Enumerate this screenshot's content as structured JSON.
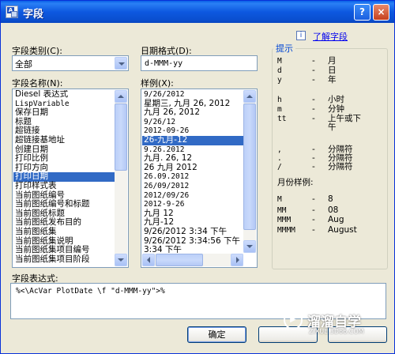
{
  "window": {
    "title": "字段",
    "help_button": "?",
    "close_button": "×"
  },
  "category": {
    "label": "字段类别(C):",
    "value": "全部"
  },
  "date_format": {
    "label": "日期格式(D):",
    "value": "d-MMM-yy"
  },
  "field_names": {
    "label": "字段名称(N):",
    "items": [
      "Diesel 表达式",
      "LispVariable",
      "保存日期",
      "标题",
      "超链接",
      "超链接基地址",
      "创建日期",
      "打印比例",
      "打印方向",
      "打印日期",
      "打印样式表",
      "当前图纸编号",
      "当前图纸编号和标题",
      "当前图纸标题",
      "当前图纸发布目的",
      "当前图纸集",
      "当前图纸集说明",
      "当前图纸集项目编号",
      "当前图纸集项目阶段"
    ],
    "selected": "打印日期"
  },
  "examples": {
    "label": "样例(X):",
    "items": [
      "9/26/2012",
      "星期三, 九月 26, 2012",
      "九月 26, 2012",
      "9/26/12",
      "2012-09-26",
      "26-九月-12",
      "9.26.2012",
      "九月. 26, 12",
      "26 九月 2012",
      "26.09.2012",
      "26/09/2012",
      "2012/09/26",
      "2012-9-26",
      "九月 12",
      "九月-12",
      "9/26/2012 3:34 下午",
      "9/26/2012 3:34:56 下午",
      "3:34 下午",
      "3:34:56 下午"
    ],
    "selected": "26-九月-12"
  },
  "help_link": "了解字段",
  "hints": {
    "title": "提示",
    "rows": [
      {
        "code": "M",
        "dash": "-",
        "text": "月"
      },
      {
        "code": "d",
        "dash": "-",
        "text": "日"
      },
      {
        "code": "y",
        "dash": "-",
        "text": "年"
      },
      {
        "code": "h",
        "dash": "-",
        "text": "小时"
      },
      {
        "code": "m",
        "dash": "-",
        "text": "分钟"
      },
      {
        "code": "tt",
        "dash": "-",
        "text": "上午或下"
      },
      {
        "code": "",
        "dash": "",
        "text": "午"
      },
      {
        "code": ",",
        "dash": "-",
        "text": "分隔符"
      },
      {
        "code": ".",
        "dash": "-",
        "text": "分隔符"
      },
      {
        "code": "/",
        "dash": "-",
        "text": "分隔符"
      }
    ],
    "month_title": "月份样例:",
    "month_rows": [
      {
        "code": "M",
        "dash": "-",
        "text": "8"
      },
      {
        "code": "MM",
        "dash": "-",
        "text": "08"
      },
      {
        "code": "MMM",
        "dash": "-",
        "text": "Aug"
      },
      {
        "code": "MMMM",
        "dash": "-",
        "text": "August"
      }
    ]
  },
  "expression": {
    "label": "字段表达式:",
    "value": "%<\\AcVar PlotDate \\f \"d-MMM-yy\">%"
  },
  "buttons": {
    "ok": "确定"
  },
  "watermark": {
    "text": "溜溜自学",
    "sub": "ZIXUE.3D66.COM"
  }
}
